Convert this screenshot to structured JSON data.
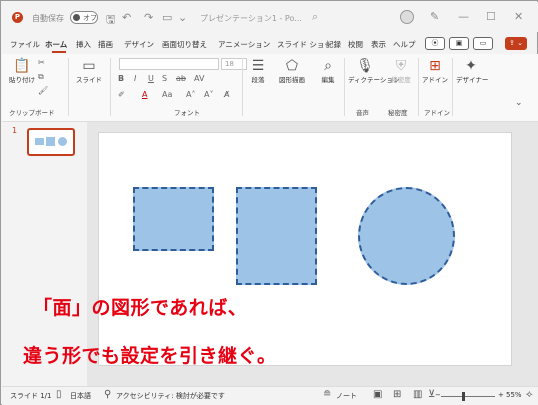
{
  "titlebar": {
    "app_logo": "P",
    "autosave_label": "自動保存",
    "autosave_state": "オフ",
    "doc_title": "プレゼンテーション1 - Po...",
    "save_icon": "save-icon",
    "undo_icon": "undo-icon",
    "redo_icon": "redo-icon"
  },
  "menu": {
    "tabs": [
      "ファイル",
      "ホーム",
      "挿入",
      "描画",
      "デザイン",
      "画面切り替え",
      "アニメーション",
      "スライド ショー",
      "記録",
      "校閲",
      "表示",
      "ヘルプ"
    ],
    "active": "ホーム"
  },
  "ribbon": {
    "paste_label": "貼り付け",
    "clipboard_group": "クリップボード",
    "slide_label": "スライド",
    "font_group": "フォント",
    "font_size": "18",
    "paragraph_label": "段落",
    "shapes_label": "図形描画",
    "edit_label": "編集",
    "dictate_label": "ディクテーション",
    "voice_group": "音声",
    "sensitivity_label": "秘密度",
    "sensitivity_group": "秘密度",
    "addin_label": "アドイン",
    "addin_group": "アドイン",
    "designer_label": "デザイナー"
  },
  "thumbnails": {
    "slide_number": "1"
  },
  "slide": {
    "caption_line1": "「面」の図形であれば、",
    "caption_line2": "違う形でも設定を引き継ぐ。"
  },
  "status": {
    "slide_info": "スライド 1/1",
    "language": "日本語",
    "accessibility": "アクセシビリティ: 検討が必要です",
    "notes_label": "ノート",
    "zoom": "55%"
  },
  "colors": {
    "accent": "#c43e1c",
    "shape_fill": "#9dc3e6",
    "shape_border": "#2e5d9a",
    "caption_text": "#e60012"
  }
}
